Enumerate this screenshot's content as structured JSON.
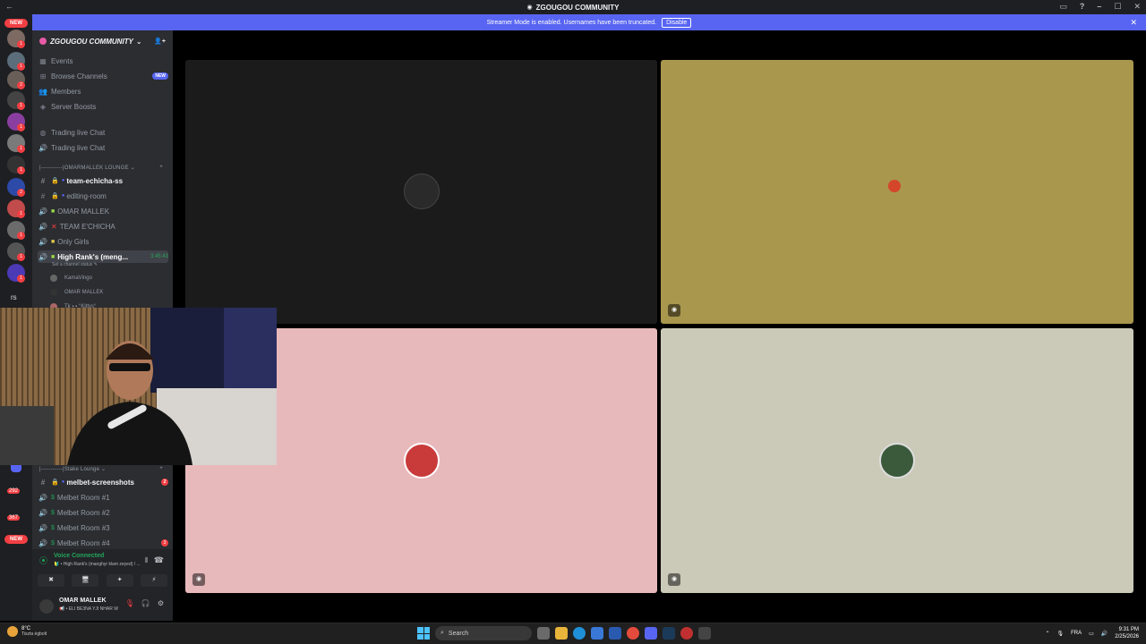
{
  "window": {
    "back": "←",
    "title": "ZGOUGOU COMMUNITY",
    "controls": [
      "▭",
      "?",
      "–",
      "☐",
      "✕"
    ]
  },
  "banner": {
    "text": "Streamer Mode is enabled. Usernames have been truncated.",
    "button": "Disable",
    "close": "✕"
  },
  "guilds": {
    "new_top": "NEW",
    "new_bottom": "NEW",
    "badges": [
      "1",
      "1",
      "2",
      "1",
      "1",
      "1",
      "1",
      "2",
      "1",
      "1",
      "1",
      "1",
      "2"
    ],
    "initials": "rs",
    "count1": "292",
    "count2": "367"
  },
  "server": {
    "name": "ZGOUGOU COMMUNITY",
    "caret": "⌄",
    "invite_icon": "👤+"
  },
  "menu": [
    {
      "label": "Events",
      "icon": "calendar-icon"
    },
    {
      "label": "Browse Channels",
      "icon": "browse-icon",
      "tag": "NEW"
    },
    {
      "label": "Members",
      "icon": "members-icon"
    },
    {
      "label": "Server Boosts",
      "icon": "boost-icon"
    }
  ],
  "channels_top": [
    {
      "label": "Trading live Chat",
      "icon": "forum-icon"
    },
    {
      "label": "Trading live Chat",
      "icon": "voice-icon"
    }
  ],
  "category1": {
    "label": "|-----------|OMARMALLEK LOUNGE ⌄",
    "plus": "+"
  },
  "channels_lounge": [
    {
      "label": "team-echicha-ss",
      "bold": true
    },
    {
      "label": "editing-room",
      "bold": false
    },
    {
      "label": "OMAR MALLEK",
      "bold": false
    },
    {
      "label": "TEAM E'CHICHA",
      "bold": false
    },
    {
      "label": "Only Girls",
      "bold": false
    }
  ],
  "active_channel": {
    "label": "High Rank's (meng...",
    "time": "3:45:43",
    "status": "Set a channel status ✎"
  },
  "voice_users": [
    {
      "name": "KamaVingo"
    },
    {
      "name": "OMAR MALLEK"
    },
    {
      "name": "Tk ▪ ▪ °Kittys°"
    }
  ],
  "category2": {
    "label": "|-----------|Stake Lounge ⌄",
    "plus": "+"
  },
  "channels_stake": [
    {
      "label": "melbet-screenshots",
      "bold": true,
      "badge": "2"
    },
    {
      "label": "Melbet Room #1",
      "bold": false
    },
    {
      "label": "Melbet Room #2",
      "bold": false
    },
    {
      "label": "Melbet Room #3",
      "bold": false
    },
    {
      "label": "Melbet Room #4",
      "bold": false,
      "badge": "3"
    }
  ],
  "voice": {
    "title": "Voice Connected",
    "subtitle": "🔰 • High Rank's (manghyr klam zeyed) / ...",
    "buttons": [
      "✖",
      "🖥",
      "✦",
      "⚡"
    ]
  },
  "user": {
    "name": "OMAR MALLEK",
    "status": "📢 • ELI BE3NA YJI NHAR W",
    "mic": "🎙",
    "headset": "🎧",
    "settings": "⚙"
  },
  "tiles": [
    {
      "color": "#1b1b1b"
    },
    {
      "color": "#a8974d"
    },
    {
      "color": "#e8b9bb"
    },
    {
      "color": "#cbc9b8"
    }
  ],
  "taskbar": {
    "temp": "8°C",
    "weather": "Tiszta égbolt",
    "search": "Search",
    "lang": "FRA",
    "time": "9:31 PM",
    "date": "2/25/2026"
  },
  "colors": {
    "accent": "#5865f2",
    "danger": "#f23f43",
    "online": "#23a55a"
  }
}
